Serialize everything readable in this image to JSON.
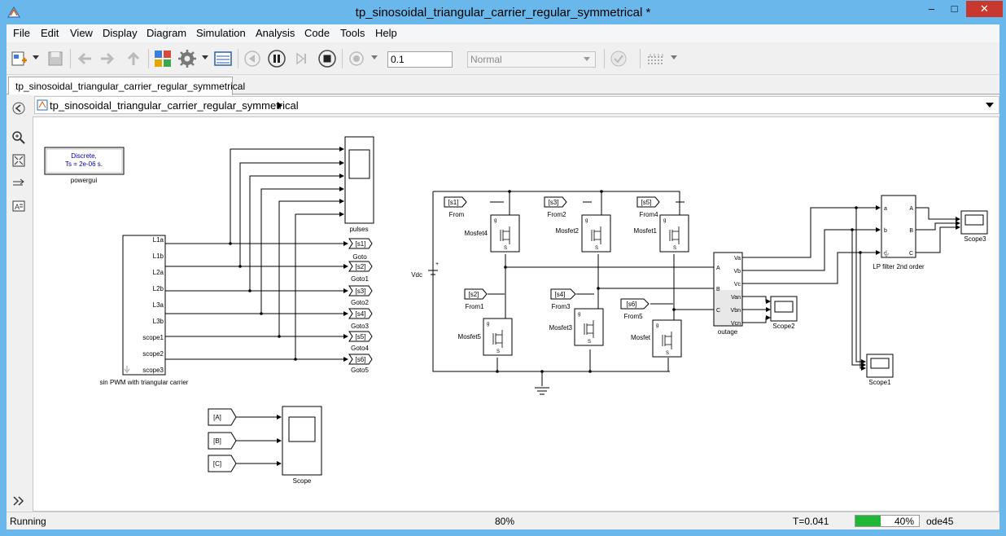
{
  "window": {
    "title": "tp_sinosoidal_triangular_carrier_regular_symmetrical *"
  },
  "menu": [
    "File",
    "Edit",
    "View",
    "Display",
    "Diagram",
    "Simulation",
    "Analysis",
    "Code",
    "Tools",
    "Help"
  ],
  "toolbar": {
    "stop_time": "0.1",
    "sim_mode": "Normal"
  },
  "tab": {
    "label": "tp_sinosoidal_triangular_carrier_regular_symmetrical"
  },
  "address": {
    "path": "tp_sinosoidal_triangular_carrier_regular_symmetrical"
  },
  "status": {
    "state": "Running",
    "zoom": "80%",
    "time": "T=0.041",
    "progress_label": "40%",
    "progress": 0.4,
    "solver": "ode45"
  },
  "colors": {
    "progress_fill": "#1fb735",
    "close_button": "#c7392e",
    "canvas": "#ffffff",
    "powergui_text": "#0000a0"
  },
  "icons": [
    "matlab-simulink-icon",
    "new-model-icon",
    "save-icon",
    "back-icon",
    "forward-icon",
    "up-icon",
    "library-browser-icon",
    "model-config-icon",
    "model-explorer-icon",
    "step-back-icon",
    "pause-icon",
    "step-forward-icon",
    "stop-icon",
    "record-icon",
    "check-icon",
    "build-icon",
    "zoom-icon",
    "fit-view-icon",
    "arrow-icon",
    "annotation-icon",
    "expand-icon"
  ],
  "diagram": {
    "powergui": {
      "line1": "Discrete,",
      "line2": "Ts = 2e-06 s.",
      "name": "powergui"
    },
    "spwm": {
      "name": "sin PWM with triangular carrier",
      "ports": [
        "L1a",
        "L1b",
        "L2a",
        "L2b",
        "L3a",
        "L3b",
        "scope1",
        "scope2",
        "scope3"
      ]
    },
    "pulses_scope": {
      "name": "pulses"
    },
    "gotos": [
      {
        "tag": "[s1]",
        "name": "Goto"
      },
      {
        "tag": "[s2]",
        "name": "Goto1"
      },
      {
        "tag": "[s3]",
        "name": "Goto2"
      },
      {
        "tag": "[s4]",
        "name": "Goto3"
      },
      {
        "tag": "[s5]",
        "name": "Goto4"
      },
      {
        "tag": "[s6]",
        "name": "Goto5"
      }
    ],
    "froms_bottom": [
      {
        "tag": "[A]"
      },
      {
        "tag": "[B]"
      },
      {
        "tag": "[C]"
      }
    ],
    "scope_bottom": {
      "name": "Scope"
    },
    "vdc": {
      "name": "Vdc"
    },
    "froms": [
      {
        "tag": "[s1]",
        "name": "From"
      },
      {
        "tag": "[s3]",
        "name": "From2"
      },
      {
        "tag": "[s5]",
        "name": "From4"
      },
      {
        "tag": "[s2]",
        "name": "From1"
      },
      {
        "tag": "[s4]",
        "name": "From3"
      },
      {
        "tag": "[s6]",
        "name": "From5"
      }
    ],
    "mosfets": [
      {
        "name": "Mosfet4"
      },
      {
        "name": "Mosfet2"
      },
      {
        "name": "Mosfet1"
      },
      {
        "name": "Mosfet5"
      },
      {
        "name": "Mosfet3"
      },
      {
        "name": "Mosfet"
      }
    ],
    "mosfet_g": "g",
    "mosfet_s": "S",
    "measurement": {
      "name": "outage",
      "in_ports": [
        "A",
        "B",
        "C"
      ],
      "out_ports": [
        "Va",
        "Vb",
        "Vc",
        "Van",
        "Vbn",
        "Vcn"
      ]
    },
    "scope2": {
      "name": "Scope2"
    },
    "lp_filter": {
      "name": "LP filter 2nd order",
      "in_ports": [
        "a",
        "b",
        "c"
      ],
      "out_ports": [
        "A",
        "B",
        "C"
      ]
    },
    "scope3": {
      "name": "Scope3"
    },
    "scope1": {
      "name": "Scope1"
    }
  }
}
